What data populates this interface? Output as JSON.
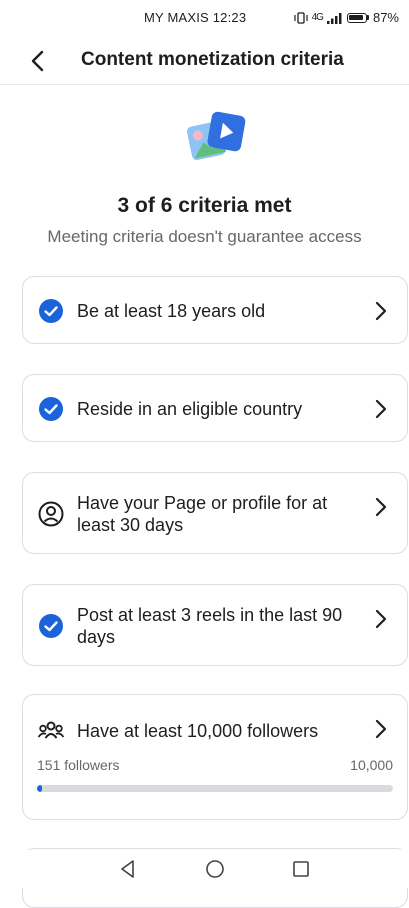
{
  "status_bar": {
    "carrier": "MY MAXIS",
    "time": "12:23",
    "signal_text": "4G",
    "battery": "87%"
  },
  "header": {
    "title": "Content monetization criteria",
    "back_icon": "chevron-left-icon"
  },
  "summary": {
    "count_text": "3 of 6 criteria met",
    "subtitle": "Meeting criteria doesn't guarantee access"
  },
  "criteria": [
    {
      "label": "Be at least 18 years old",
      "status": "met",
      "icon": "check-circle-icon"
    },
    {
      "label": "Reside in an eligible country",
      "status": "met",
      "icon": "check-circle-icon"
    },
    {
      "label": "Have your Page or profile for at least 30 days",
      "status": "not-met",
      "icon": "profile-circle-icon"
    },
    {
      "label": "Post at least 3 reels in the last 90 days",
      "status": "met",
      "icon": "check-circle-icon"
    },
    {
      "label": "Have at least 10,000 followers",
      "status": "not-met",
      "icon": "people-icon",
      "progress": {
        "current_label": "151 followers",
        "target_label": "10,000",
        "current": 151,
        "target": 10000
      }
    }
  ],
  "colors": {
    "accent": "#1b63d9",
    "text": "#1c1e21",
    "secondary_text": "#65676b",
    "border": "#dadde1"
  },
  "nav": {
    "back": "triangle-back-icon",
    "home": "circle-home-icon",
    "recents": "square-recents-icon"
  }
}
